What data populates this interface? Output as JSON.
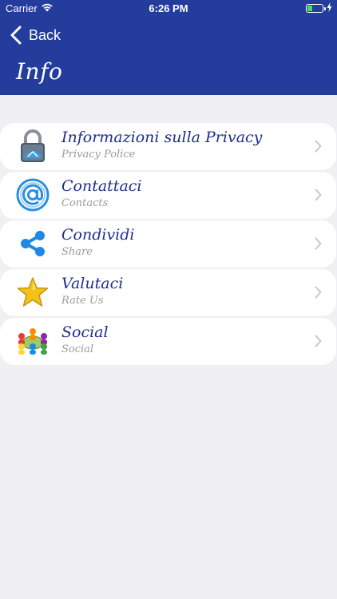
{
  "status_bar": {
    "carrier": "Carrier",
    "time": "6:26 PM",
    "battery_level": 0.35,
    "charging": true
  },
  "nav": {
    "back_label": "Back",
    "title": "Info"
  },
  "colors": {
    "header": "#243c9c",
    "background": "#efeff4",
    "item_title": "#1f2e8c",
    "item_subtitle": "#9a9a9a"
  },
  "items": [
    {
      "title": "Informazioni sulla Privacy",
      "subtitle": "Privacy Police",
      "icon": "padlock-icon"
    },
    {
      "title": "Contattaci",
      "subtitle": "Contacts",
      "icon": "at-sign-icon"
    },
    {
      "title": "Condividi",
      "subtitle": "Share",
      "icon": "share-icon"
    },
    {
      "title": "Valutaci",
      "subtitle": "Rate Us",
      "icon": "star-icon"
    },
    {
      "title": "Social",
      "subtitle": "Social",
      "icon": "people-network-icon"
    }
  ]
}
